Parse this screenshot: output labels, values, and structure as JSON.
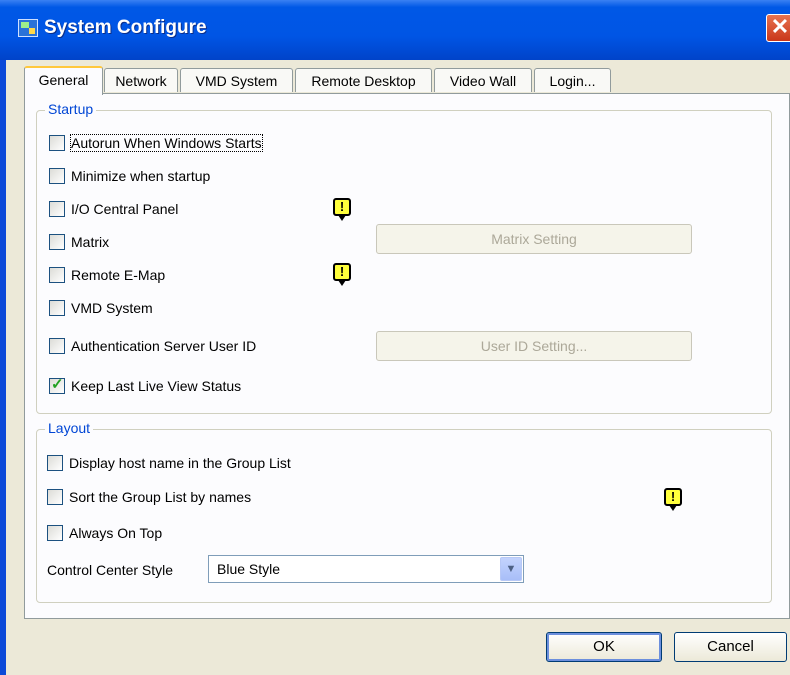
{
  "window": {
    "title": "System Configure",
    "close_label": "✕"
  },
  "tabs": [
    {
      "label": "General"
    },
    {
      "label": "Network"
    },
    {
      "label": "VMD System"
    },
    {
      "label": "Remote Desktop"
    },
    {
      "label": "Video Wall"
    },
    {
      "label": "Login..."
    }
  ],
  "startup": {
    "legend": "Startup",
    "autorun": {
      "label": "Autorun When Windows Starts",
      "checked": false
    },
    "minimize": {
      "label": "Minimize when startup",
      "checked": false
    },
    "io_panel": {
      "label": "I/O Central Panel",
      "checked": false
    },
    "matrix": {
      "label": "Matrix",
      "checked": false
    },
    "remote_emap": {
      "label": "Remote E-Map",
      "checked": false
    },
    "vmd_system": {
      "label": "VMD System",
      "checked": false
    },
    "auth_server": {
      "label": "Authentication Server User ID",
      "checked": false
    },
    "keep_live": {
      "label": "Keep Last Live View Status",
      "checked": true
    },
    "matrix_setting_label": "Matrix Setting",
    "user_id_setting_label": "User ID Setting..."
  },
  "layout": {
    "legend": "Layout",
    "display_host": {
      "label": "Display host name in the Group List",
      "checked": false
    },
    "sort_group": {
      "label": "Sort the Group List by names",
      "checked": false
    },
    "always_on_top": {
      "label": "Always On Top",
      "checked": false
    },
    "style_label": "Control Center Style",
    "style_value": "Blue Style"
  },
  "warning_glyph": "!",
  "buttons": {
    "ok": "OK",
    "cancel": "Cancel"
  }
}
